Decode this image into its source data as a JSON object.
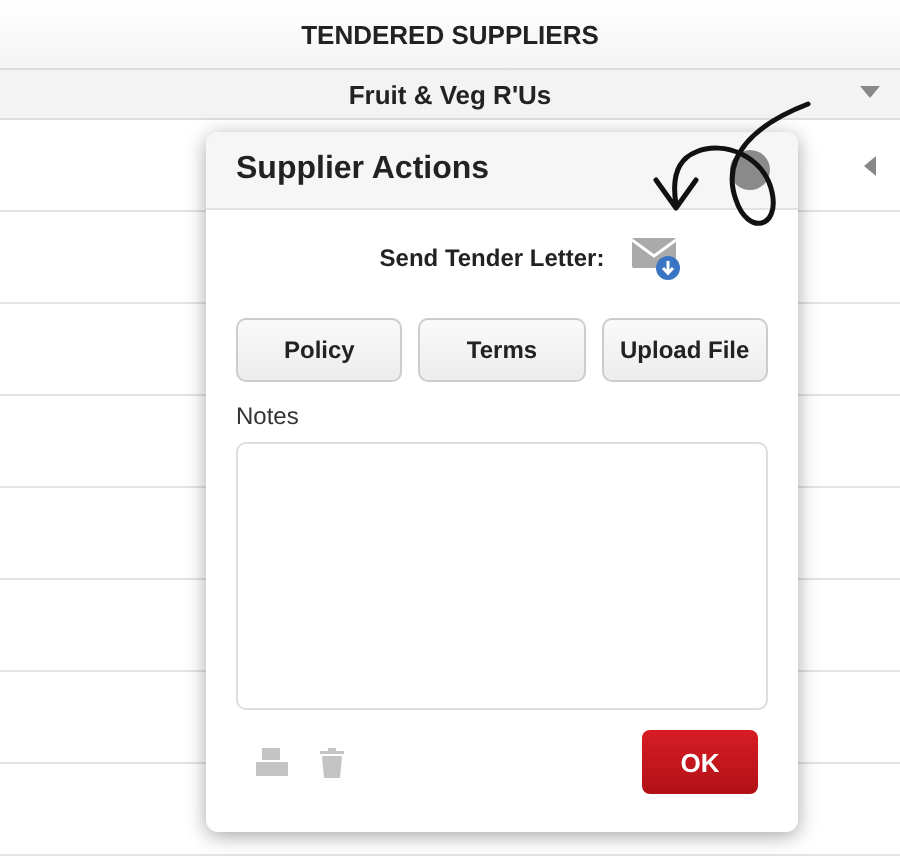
{
  "list": {
    "title": "TENDERED SUPPLIERS",
    "group": {
      "name": "Fruit & Veg R'Us",
      "expanded": true
    }
  },
  "dialog": {
    "title": "Supplier Actions",
    "send_letter_label": "Send Tender Letter:",
    "buttons": [
      "Policy",
      "Terms",
      "Upload File"
    ],
    "notes_label": "Notes",
    "ok_button": "OK"
  }
}
